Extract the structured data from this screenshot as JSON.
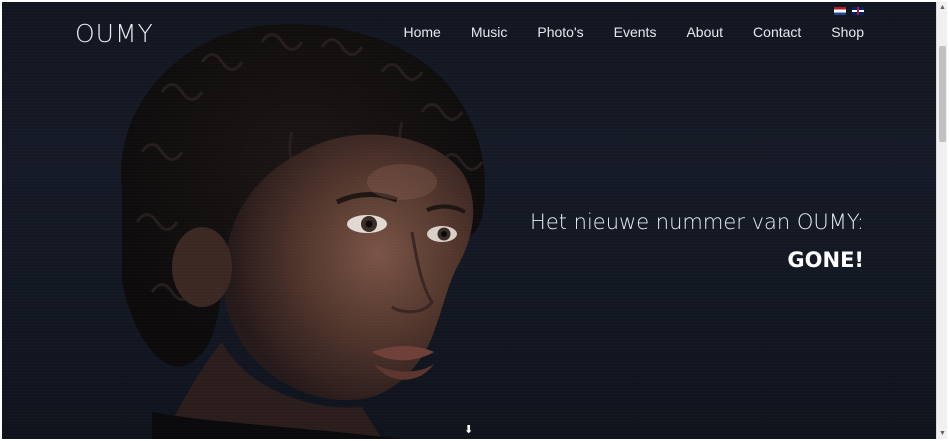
{
  "header": {
    "logo": "OUMY",
    "nav": [
      "Home",
      "Music",
      "Photo's",
      "Events",
      "About",
      "Contact",
      "Shop"
    ],
    "languages": [
      {
        "code": "nl",
        "icon": "dutch-flag-icon"
      },
      {
        "code": "en",
        "icon": "uk-flag-icon"
      }
    ]
  },
  "hero": {
    "headline": "Het nieuwe nummer van OUMY:",
    "subheadline": "GONE!",
    "scroll_icon": "arrow-down-icon",
    "scroll_glyph": "⬇"
  },
  "scrollbar": {
    "up_glyph": "▲",
    "down_glyph": "▼"
  },
  "colors": {
    "background": "#131823",
    "text": "#e8ecf2"
  }
}
